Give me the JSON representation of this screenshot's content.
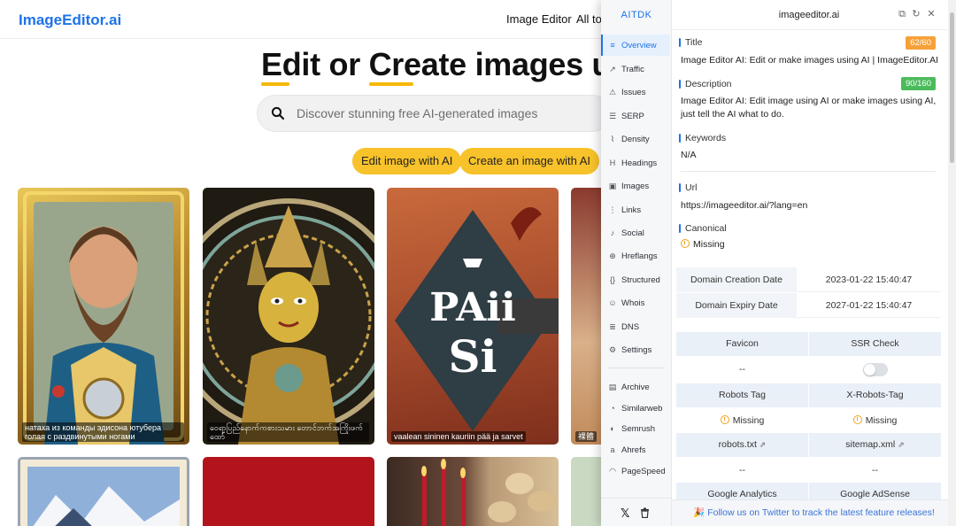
{
  "site": {
    "logo": "ImageEditor.ai",
    "nav": [
      "Image Editor",
      "All to"
    ],
    "hero": {
      "part1": "Edit",
      "part2": " or ",
      "part3": "Create",
      "part4": " images us"
    },
    "search_placeholder": "Discover stunning free AI-generated images",
    "buttons": {
      "edit": "Edit image with AI",
      "create": "Create an image with AI"
    },
    "cards": [
      {
        "caption": "натаха из команды эдисона ютубера голая с раздвинутыми ногами"
      },
      {
        "caption": "ဝေရာ့ပြည်နောက်ကစားသမား တောင်ဘက်အကြိုးဖက် ထော်"
      },
      {
        "caption": "vaalean sininen kauriin pää ja sarvet"
      },
      {
        "caption": "裸體"
      }
    ],
    "card_art": {
      "sign_line1": "PAii",
      "sign_line2": "Si"
    }
  },
  "extension": {
    "brand": "AITDK",
    "domain": "imageeditor.ai",
    "sidebar": [
      {
        "label": "Overview",
        "icon": "overview-icon",
        "active": true
      },
      {
        "label": "Traffic",
        "icon": "traffic-icon"
      },
      {
        "label": "Issues",
        "icon": "issues-icon"
      },
      {
        "label": "SERP",
        "icon": "serp-icon"
      },
      {
        "label": "Density",
        "icon": "density-icon"
      },
      {
        "label": "Headings",
        "icon": "headings-icon"
      },
      {
        "label": "Images",
        "icon": "images-icon"
      },
      {
        "label": "Links",
        "icon": "links-icon"
      },
      {
        "label": "Social",
        "icon": "social-icon"
      },
      {
        "label": "Hreflangs",
        "icon": "hreflangs-icon"
      },
      {
        "label": "Structured",
        "icon": "structured-icon"
      },
      {
        "label": "Whois",
        "icon": "whois-icon"
      },
      {
        "label": "DNS",
        "icon": "dns-icon"
      },
      {
        "label": "Settings",
        "icon": "settings-icon"
      },
      {
        "label": "Archive",
        "icon": "archive-icon"
      },
      {
        "label": "Similarweb",
        "icon": "similarweb-icon"
      },
      {
        "label": "Semrush",
        "icon": "semrush-icon"
      },
      {
        "label": "Ahrefs",
        "icon": "ahrefs-icon"
      },
      {
        "label": "PageSpeed",
        "icon": "pagespeed-icon"
      }
    ],
    "title": {
      "label": "Title",
      "badge": "62/60",
      "value": "Image Editor AI: Edit or make images using AI | ImageEditor.AI"
    },
    "description": {
      "label": "Description",
      "badge": "90/160",
      "value": "Image Editor AI: Edit image using AI or make images using AI, just tell the AI what to do."
    },
    "keywords": {
      "label": "Keywords",
      "value": "N/A"
    },
    "url": {
      "label": "Url",
      "value": "https://imageeditor.ai/?lang=en"
    },
    "canonical": {
      "label": "Canonical",
      "value": "Missing"
    },
    "domain_dates": [
      {
        "label": "Domain Creation Date",
        "value": "2023-01-22 15:40:47"
      },
      {
        "label": "Domain Expiry Date",
        "value": "2027-01-22 15:40:47"
      }
    ],
    "checks": {
      "favicon": {
        "label": "Favicon",
        "value": "--"
      },
      "ssr": {
        "label": "SSR Check"
      },
      "robots_tag": {
        "label": "Robots Tag",
        "value": "Missing"
      },
      "x_robots_tag": {
        "label": "X-Robots-Tag",
        "value": "Missing"
      },
      "robots_txt": {
        "label": "robots.txt",
        "value": "--"
      },
      "sitemap": {
        "label": "sitemap.xml",
        "value": "--"
      },
      "analytics": {
        "label": "Google Analytics"
      },
      "adsense": {
        "label": "Google AdSense"
      }
    },
    "footer": "🎉 Follow us on Twitter to track the latest feature releases!"
  },
  "colors": {
    "accent": "#1e73e8",
    "yellow": "#f7c22a",
    "badge_orange": "#f6a13a",
    "badge_green": "#4cbb5c",
    "warning": "#f0a020"
  }
}
